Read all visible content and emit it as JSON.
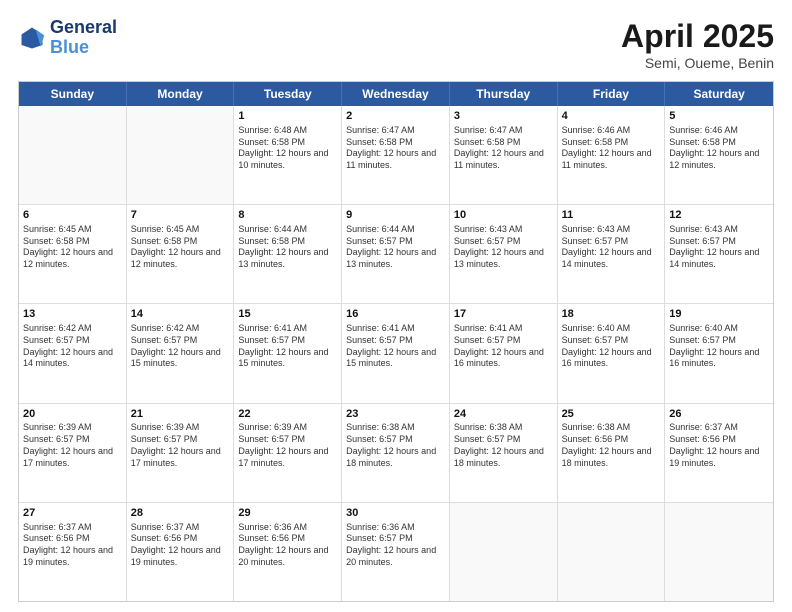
{
  "header": {
    "logo_line1": "General",
    "logo_line2": "Blue",
    "title": "April 2025",
    "subtitle": "Semi, Oueme, Benin"
  },
  "days_of_week": [
    "Sunday",
    "Monday",
    "Tuesday",
    "Wednesday",
    "Thursday",
    "Friday",
    "Saturday"
  ],
  "weeks": [
    [
      {
        "day": "",
        "info": ""
      },
      {
        "day": "",
        "info": ""
      },
      {
        "day": "1",
        "info": "Sunrise: 6:48 AM\nSunset: 6:58 PM\nDaylight: 12 hours and 10 minutes."
      },
      {
        "day": "2",
        "info": "Sunrise: 6:47 AM\nSunset: 6:58 PM\nDaylight: 12 hours and 11 minutes."
      },
      {
        "day": "3",
        "info": "Sunrise: 6:47 AM\nSunset: 6:58 PM\nDaylight: 12 hours and 11 minutes."
      },
      {
        "day": "4",
        "info": "Sunrise: 6:46 AM\nSunset: 6:58 PM\nDaylight: 12 hours and 11 minutes."
      },
      {
        "day": "5",
        "info": "Sunrise: 6:46 AM\nSunset: 6:58 PM\nDaylight: 12 hours and 12 minutes."
      }
    ],
    [
      {
        "day": "6",
        "info": "Sunrise: 6:45 AM\nSunset: 6:58 PM\nDaylight: 12 hours and 12 minutes."
      },
      {
        "day": "7",
        "info": "Sunrise: 6:45 AM\nSunset: 6:58 PM\nDaylight: 12 hours and 12 minutes."
      },
      {
        "day": "8",
        "info": "Sunrise: 6:44 AM\nSunset: 6:58 PM\nDaylight: 12 hours and 13 minutes."
      },
      {
        "day": "9",
        "info": "Sunrise: 6:44 AM\nSunset: 6:57 PM\nDaylight: 12 hours and 13 minutes."
      },
      {
        "day": "10",
        "info": "Sunrise: 6:43 AM\nSunset: 6:57 PM\nDaylight: 12 hours and 13 minutes."
      },
      {
        "day": "11",
        "info": "Sunrise: 6:43 AM\nSunset: 6:57 PM\nDaylight: 12 hours and 14 minutes."
      },
      {
        "day": "12",
        "info": "Sunrise: 6:43 AM\nSunset: 6:57 PM\nDaylight: 12 hours and 14 minutes."
      }
    ],
    [
      {
        "day": "13",
        "info": "Sunrise: 6:42 AM\nSunset: 6:57 PM\nDaylight: 12 hours and 14 minutes."
      },
      {
        "day": "14",
        "info": "Sunrise: 6:42 AM\nSunset: 6:57 PM\nDaylight: 12 hours and 15 minutes."
      },
      {
        "day": "15",
        "info": "Sunrise: 6:41 AM\nSunset: 6:57 PM\nDaylight: 12 hours and 15 minutes."
      },
      {
        "day": "16",
        "info": "Sunrise: 6:41 AM\nSunset: 6:57 PM\nDaylight: 12 hours and 15 minutes."
      },
      {
        "day": "17",
        "info": "Sunrise: 6:41 AM\nSunset: 6:57 PM\nDaylight: 12 hours and 16 minutes."
      },
      {
        "day": "18",
        "info": "Sunrise: 6:40 AM\nSunset: 6:57 PM\nDaylight: 12 hours and 16 minutes."
      },
      {
        "day": "19",
        "info": "Sunrise: 6:40 AM\nSunset: 6:57 PM\nDaylight: 12 hours and 16 minutes."
      }
    ],
    [
      {
        "day": "20",
        "info": "Sunrise: 6:39 AM\nSunset: 6:57 PM\nDaylight: 12 hours and 17 minutes."
      },
      {
        "day": "21",
        "info": "Sunrise: 6:39 AM\nSunset: 6:57 PM\nDaylight: 12 hours and 17 minutes."
      },
      {
        "day": "22",
        "info": "Sunrise: 6:39 AM\nSunset: 6:57 PM\nDaylight: 12 hours and 17 minutes."
      },
      {
        "day": "23",
        "info": "Sunrise: 6:38 AM\nSunset: 6:57 PM\nDaylight: 12 hours and 18 minutes."
      },
      {
        "day": "24",
        "info": "Sunrise: 6:38 AM\nSunset: 6:57 PM\nDaylight: 12 hours and 18 minutes."
      },
      {
        "day": "25",
        "info": "Sunrise: 6:38 AM\nSunset: 6:56 PM\nDaylight: 12 hours and 18 minutes."
      },
      {
        "day": "26",
        "info": "Sunrise: 6:37 AM\nSunset: 6:56 PM\nDaylight: 12 hours and 19 minutes."
      }
    ],
    [
      {
        "day": "27",
        "info": "Sunrise: 6:37 AM\nSunset: 6:56 PM\nDaylight: 12 hours and 19 minutes."
      },
      {
        "day": "28",
        "info": "Sunrise: 6:37 AM\nSunset: 6:56 PM\nDaylight: 12 hours and 19 minutes."
      },
      {
        "day": "29",
        "info": "Sunrise: 6:36 AM\nSunset: 6:56 PM\nDaylight: 12 hours and 20 minutes."
      },
      {
        "day": "30",
        "info": "Sunrise: 6:36 AM\nSunset: 6:57 PM\nDaylight: 12 hours and 20 minutes."
      },
      {
        "day": "",
        "info": ""
      },
      {
        "day": "",
        "info": ""
      },
      {
        "day": "",
        "info": ""
      }
    ]
  ]
}
